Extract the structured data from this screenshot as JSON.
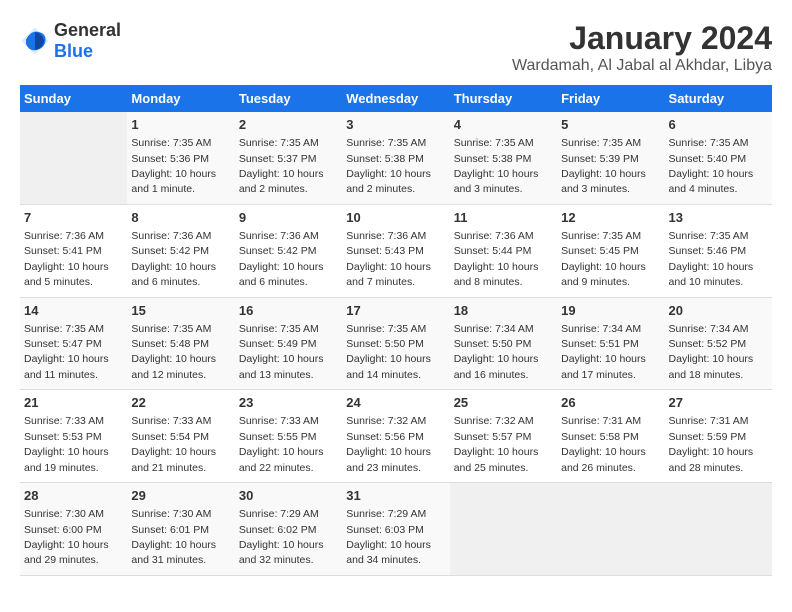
{
  "header": {
    "logo_general": "General",
    "logo_blue": "Blue",
    "month_year": "January 2024",
    "location": "Wardamah, Al Jabal al Akhdar, Libya"
  },
  "weekdays": [
    "Sunday",
    "Monday",
    "Tuesday",
    "Wednesday",
    "Thursday",
    "Friday",
    "Saturday"
  ],
  "weeks": [
    [
      {
        "day": "",
        "sunrise": "",
        "sunset": "",
        "daylight": ""
      },
      {
        "day": "1",
        "sunrise": "Sunrise: 7:35 AM",
        "sunset": "Sunset: 5:36 PM",
        "daylight": "Daylight: 10 hours and 1 minute."
      },
      {
        "day": "2",
        "sunrise": "Sunrise: 7:35 AM",
        "sunset": "Sunset: 5:37 PM",
        "daylight": "Daylight: 10 hours and 2 minutes."
      },
      {
        "day": "3",
        "sunrise": "Sunrise: 7:35 AM",
        "sunset": "Sunset: 5:38 PM",
        "daylight": "Daylight: 10 hours and 2 minutes."
      },
      {
        "day": "4",
        "sunrise": "Sunrise: 7:35 AM",
        "sunset": "Sunset: 5:38 PM",
        "daylight": "Daylight: 10 hours and 3 minutes."
      },
      {
        "day": "5",
        "sunrise": "Sunrise: 7:35 AM",
        "sunset": "Sunset: 5:39 PM",
        "daylight": "Daylight: 10 hours and 3 minutes."
      },
      {
        "day": "6",
        "sunrise": "Sunrise: 7:35 AM",
        "sunset": "Sunset: 5:40 PM",
        "daylight": "Daylight: 10 hours and 4 minutes."
      }
    ],
    [
      {
        "day": "7",
        "sunrise": "Sunrise: 7:36 AM",
        "sunset": "Sunset: 5:41 PM",
        "daylight": "Daylight: 10 hours and 5 minutes."
      },
      {
        "day": "8",
        "sunrise": "Sunrise: 7:36 AM",
        "sunset": "Sunset: 5:42 PM",
        "daylight": "Daylight: 10 hours and 6 minutes."
      },
      {
        "day": "9",
        "sunrise": "Sunrise: 7:36 AM",
        "sunset": "Sunset: 5:42 PM",
        "daylight": "Daylight: 10 hours and 6 minutes."
      },
      {
        "day": "10",
        "sunrise": "Sunrise: 7:36 AM",
        "sunset": "Sunset: 5:43 PM",
        "daylight": "Daylight: 10 hours and 7 minutes."
      },
      {
        "day": "11",
        "sunrise": "Sunrise: 7:36 AM",
        "sunset": "Sunset: 5:44 PM",
        "daylight": "Daylight: 10 hours and 8 minutes."
      },
      {
        "day": "12",
        "sunrise": "Sunrise: 7:35 AM",
        "sunset": "Sunset: 5:45 PM",
        "daylight": "Daylight: 10 hours and 9 minutes."
      },
      {
        "day": "13",
        "sunrise": "Sunrise: 7:35 AM",
        "sunset": "Sunset: 5:46 PM",
        "daylight": "Daylight: 10 hours and 10 minutes."
      }
    ],
    [
      {
        "day": "14",
        "sunrise": "Sunrise: 7:35 AM",
        "sunset": "Sunset: 5:47 PM",
        "daylight": "Daylight: 10 hours and 11 minutes."
      },
      {
        "day": "15",
        "sunrise": "Sunrise: 7:35 AM",
        "sunset": "Sunset: 5:48 PM",
        "daylight": "Daylight: 10 hours and 12 minutes."
      },
      {
        "day": "16",
        "sunrise": "Sunrise: 7:35 AM",
        "sunset": "Sunset: 5:49 PM",
        "daylight": "Daylight: 10 hours and 13 minutes."
      },
      {
        "day": "17",
        "sunrise": "Sunrise: 7:35 AM",
        "sunset": "Sunset: 5:50 PM",
        "daylight": "Daylight: 10 hours and 14 minutes."
      },
      {
        "day": "18",
        "sunrise": "Sunrise: 7:34 AM",
        "sunset": "Sunset: 5:50 PM",
        "daylight": "Daylight: 10 hours and 16 minutes."
      },
      {
        "day": "19",
        "sunrise": "Sunrise: 7:34 AM",
        "sunset": "Sunset: 5:51 PM",
        "daylight": "Daylight: 10 hours and 17 minutes."
      },
      {
        "day": "20",
        "sunrise": "Sunrise: 7:34 AM",
        "sunset": "Sunset: 5:52 PM",
        "daylight": "Daylight: 10 hours and 18 minutes."
      }
    ],
    [
      {
        "day": "21",
        "sunrise": "Sunrise: 7:33 AM",
        "sunset": "Sunset: 5:53 PM",
        "daylight": "Daylight: 10 hours and 19 minutes."
      },
      {
        "day": "22",
        "sunrise": "Sunrise: 7:33 AM",
        "sunset": "Sunset: 5:54 PM",
        "daylight": "Daylight: 10 hours and 21 minutes."
      },
      {
        "day": "23",
        "sunrise": "Sunrise: 7:33 AM",
        "sunset": "Sunset: 5:55 PM",
        "daylight": "Daylight: 10 hours and 22 minutes."
      },
      {
        "day": "24",
        "sunrise": "Sunrise: 7:32 AM",
        "sunset": "Sunset: 5:56 PM",
        "daylight": "Daylight: 10 hours and 23 minutes."
      },
      {
        "day": "25",
        "sunrise": "Sunrise: 7:32 AM",
        "sunset": "Sunset: 5:57 PM",
        "daylight": "Daylight: 10 hours and 25 minutes."
      },
      {
        "day": "26",
        "sunrise": "Sunrise: 7:31 AM",
        "sunset": "Sunset: 5:58 PM",
        "daylight": "Daylight: 10 hours and 26 minutes."
      },
      {
        "day": "27",
        "sunrise": "Sunrise: 7:31 AM",
        "sunset": "Sunset: 5:59 PM",
        "daylight": "Daylight: 10 hours and 28 minutes."
      }
    ],
    [
      {
        "day": "28",
        "sunrise": "Sunrise: 7:30 AM",
        "sunset": "Sunset: 6:00 PM",
        "daylight": "Daylight: 10 hours and 29 minutes."
      },
      {
        "day": "29",
        "sunrise": "Sunrise: 7:30 AM",
        "sunset": "Sunset: 6:01 PM",
        "daylight": "Daylight: 10 hours and 31 minutes."
      },
      {
        "day": "30",
        "sunrise": "Sunrise: 7:29 AM",
        "sunset": "Sunset: 6:02 PM",
        "daylight": "Daylight: 10 hours and 32 minutes."
      },
      {
        "day": "31",
        "sunrise": "Sunrise: 7:29 AM",
        "sunset": "Sunset: 6:03 PM",
        "daylight": "Daylight: 10 hours and 34 minutes."
      },
      {
        "day": "",
        "sunrise": "",
        "sunset": "",
        "daylight": ""
      },
      {
        "day": "",
        "sunrise": "",
        "sunset": "",
        "daylight": ""
      },
      {
        "day": "",
        "sunrise": "",
        "sunset": "",
        "daylight": ""
      }
    ]
  ]
}
